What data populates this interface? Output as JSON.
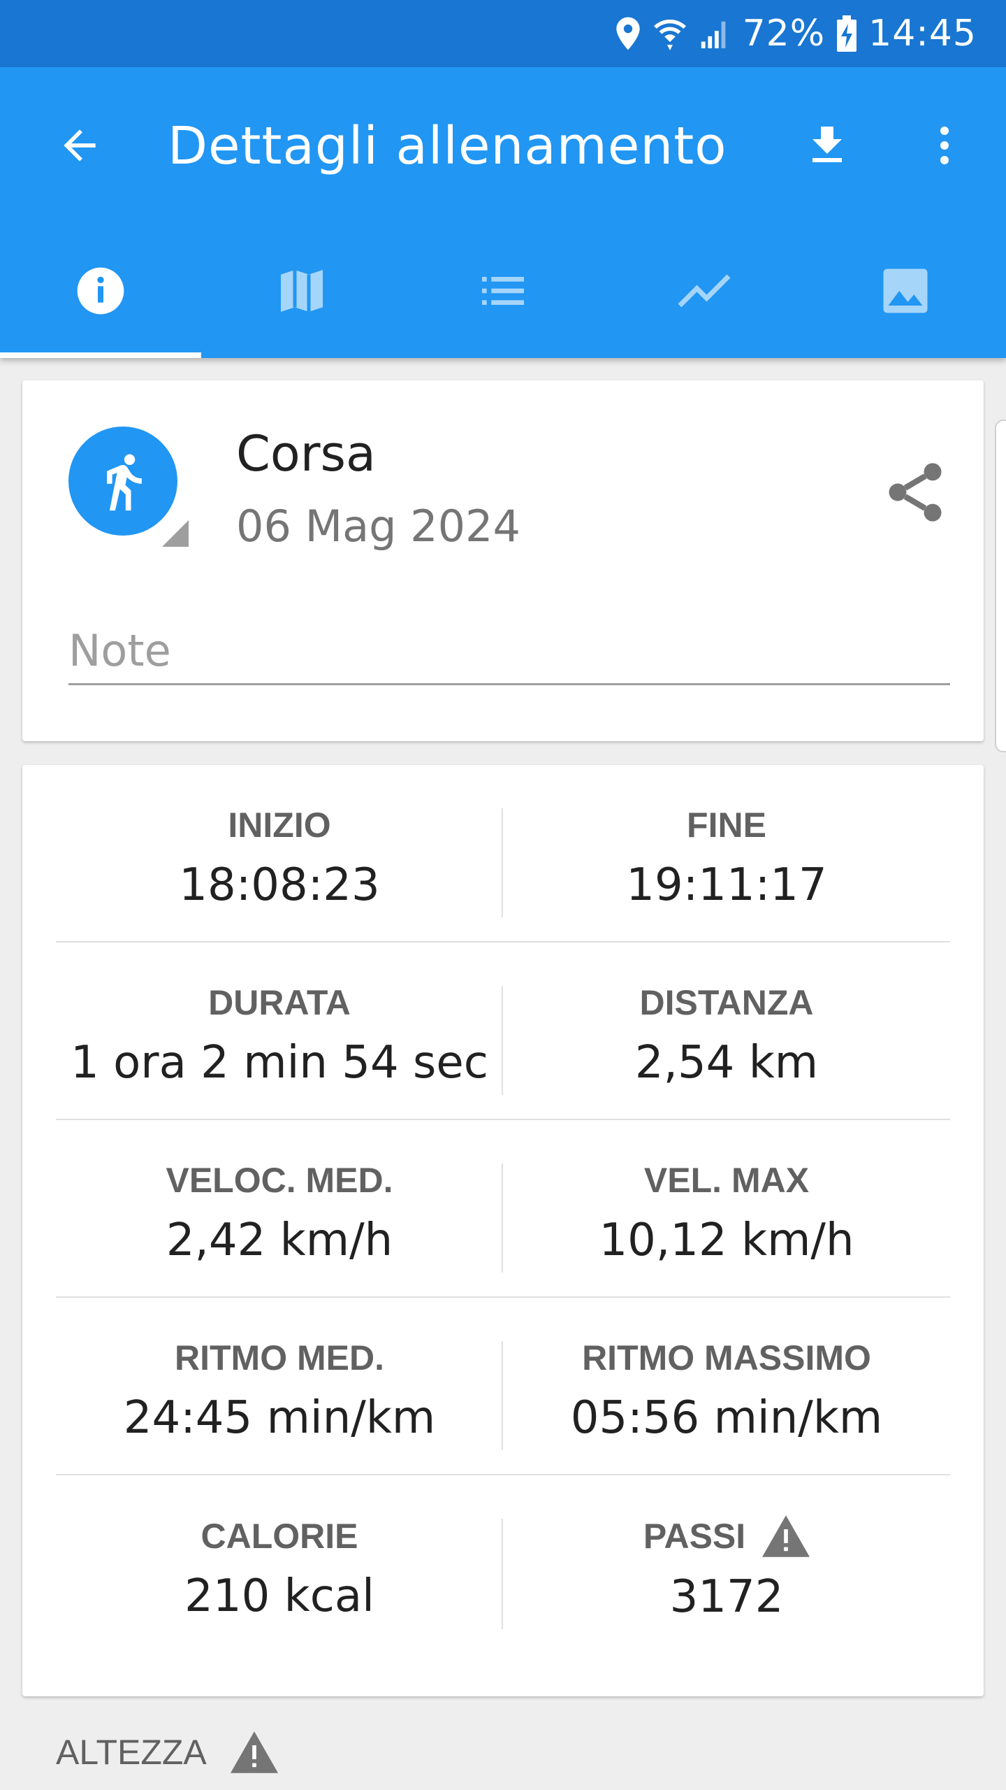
{
  "status_bar": {
    "battery_percent": "72%",
    "time": "14:45",
    "icons": [
      "location-icon",
      "wifi-icon",
      "signal-icon",
      "battery-charging-icon"
    ]
  },
  "app_bar": {
    "title": "Dettagli allenamento",
    "color": "#2196f3",
    "status_color": "#1976d2",
    "actions": [
      "download-icon",
      "more-vert-icon"
    ],
    "tabs": [
      {
        "icon": "info-icon",
        "active": true
      },
      {
        "icon": "map-icon",
        "active": false
      },
      {
        "icon": "list-icon",
        "active": false
      },
      {
        "icon": "chart-icon",
        "active": false
      },
      {
        "icon": "image-icon",
        "active": false
      }
    ]
  },
  "activity": {
    "name": "Corsa",
    "date": "06 Mag 2024",
    "icon": "running-icon",
    "note_placeholder": "Note"
  },
  "stats": [
    {
      "left": {
        "label": "INIZIO",
        "value": "18:08:23"
      },
      "right": {
        "label": "FINE",
        "value": "19:11:17"
      }
    },
    {
      "left": {
        "label": "DURATA",
        "value": "1 ora 2 min 54 sec"
      },
      "right": {
        "label": "DISTANZA",
        "value": "2,54 km"
      }
    },
    {
      "left": {
        "label": "VELOC. MED.",
        "value": "2,42 km/h"
      },
      "right": {
        "label": "VEL. MAX",
        "value": "10,12 km/h"
      }
    },
    {
      "left": {
        "label": "RITMO MED.",
        "value": "24:45 min/km"
      },
      "right": {
        "label": "RITMO MASSIMO",
        "value": "05:56 min/km"
      }
    },
    {
      "left": {
        "label": "CALORIE",
        "value": "210 kcal"
      },
      "right": {
        "label": "PASSI",
        "value": "3172",
        "warning": true
      }
    }
  ],
  "section": {
    "label": "ALTEZZA",
    "warning": true
  }
}
